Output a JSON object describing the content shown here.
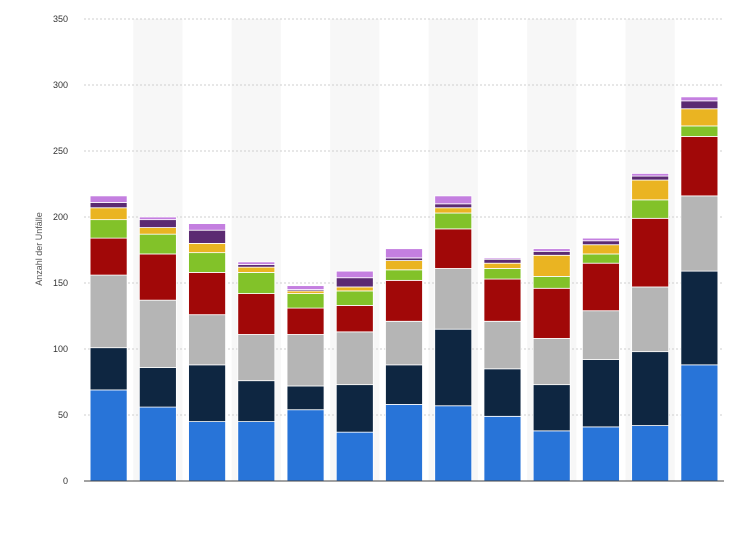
{
  "chart_data": {
    "type": "bar",
    "stacked": true,
    "title": "",
    "xlabel": "",
    "ylabel": "Anzahl der Unfälle",
    "ylim": [
      0,
      350
    ],
    "yticks": [
      0,
      50,
      100,
      150,
      200,
      250,
      300,
      350
    ],
    "grid": true,
    "legend": "none",
    "categories": [
      "",
      "",
      "",
      "",
      "",
      "",
      "",
      "",
      "",
      "",
      "",
      "",
      ""
    ],
    "series": [
      {
        "color": "#2874d8",
        "values": [
          69,
          56,
          45,
          45,
          54,
          37,
          58,
          57,
          49,
          38,
          41,
          42,
          88
        ]
      },
      {
        "color": "#0e2641",
        "values": [
          32,
          30,
          43,
          31,
          18,
          36,
          30,
          58,
          36,
          35,
          51,
          56,
          71
        ]
      },
      {
        "color": "#b5b5b5",
        "values": [
          55,
          51,
          38,
          35,
          39,
          40,
          33,
          46,
          36,
          35,
          37,
          49,
          57
        ]
      },
      {
        "color": "#a10808",
        "values": [
          28,
          35,
          32,
          31,
          20,
          20,
          31,
          30,
          32,
          38,
          36,
          52,
          45
        ]
      },
      {
        "color": "#82c229",
        "values": [
          14,
          15,
          15,
          16,
          11,
          11,
          8,
          12,
          8,
          9,
          7,
          14,
          8
        ]
      },
      {
        "color": "#eab422",
        "values": [
          9,
          5,
          7,
          4,
          2,
          3,
          7,
          4,
          4,
          16,
          7,
          15,
          13
        ]
      },
      {
        "color": "#5b2a72",
        "values": [
          4,
          6,
          10,
          2,
          1,
          7,
          2,
          3,
          3,
          3,
          3,
          3,
          6
        ]
      },
      {
        "color": "#c47fe0",
        "values": [
          5,
          2,
          5,
          2,
          3,
          5,
          7,
          6,
          1,
          2,
          2,
          2,
          3
        ]
      }
    ]
  }
}
